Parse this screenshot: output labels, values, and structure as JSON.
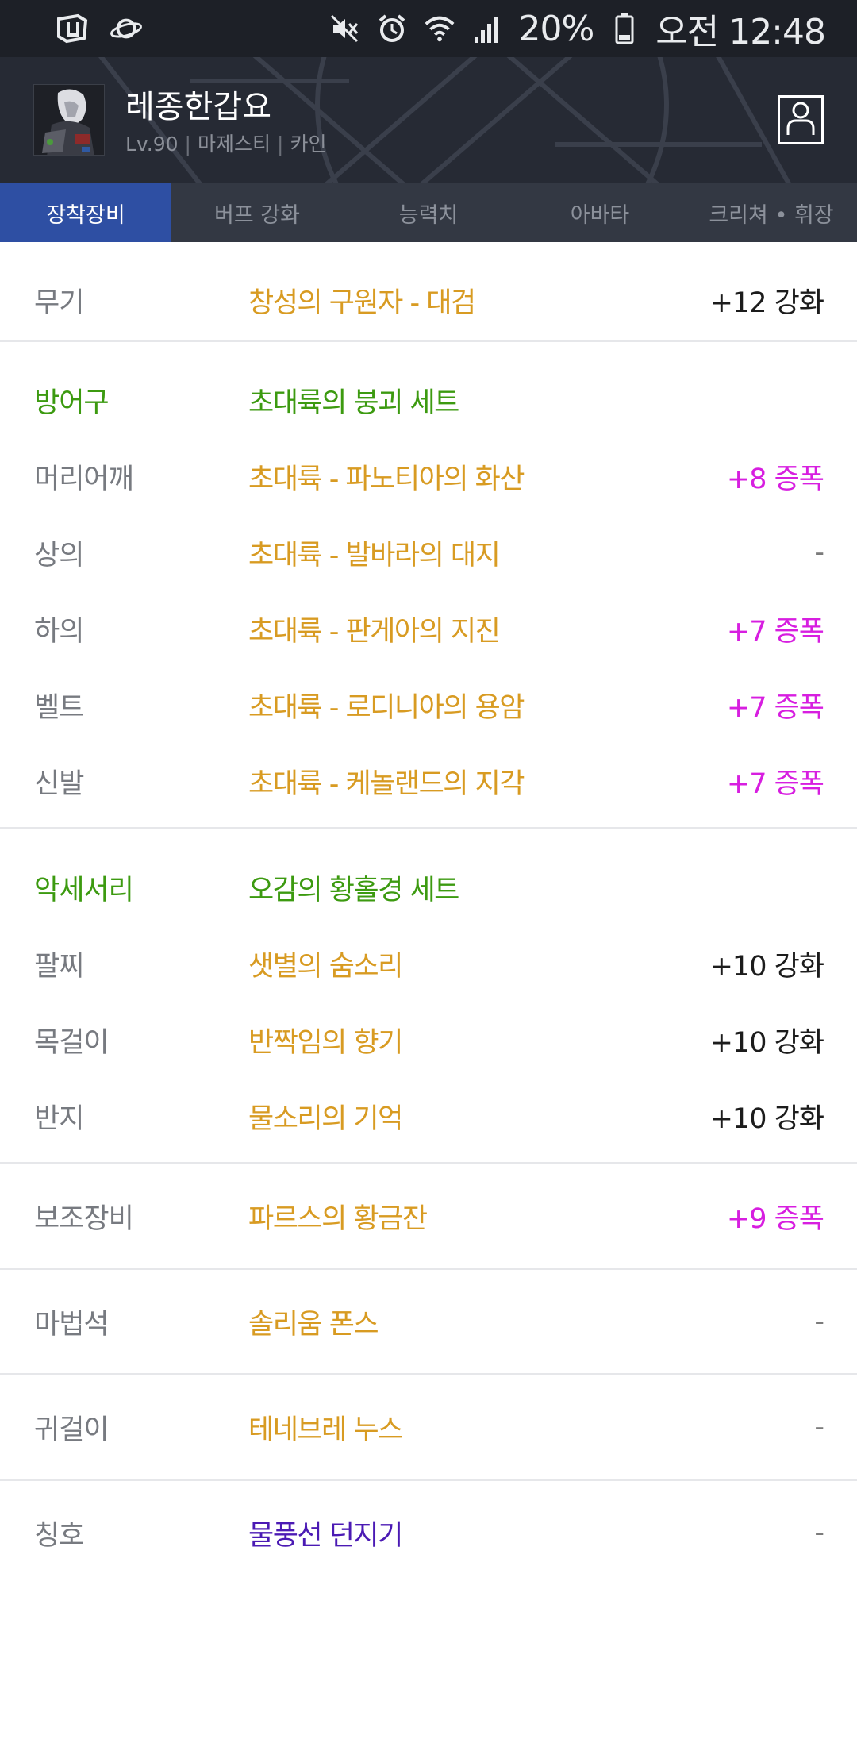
{
  "status_bar": {
    "left_icons": [
      "app-icon",
      "planet-icon"
    ],
    "right_icons": [
      "mute-icon",
      "alarm-icon",
      "wifi-icon",
      "signal-icon",
      "battery-icon"
    ],
    "battery": "20%",
    "time": "오전 12:48"
  },
  "profile": {
    "name": "레종한갑요",
    "level": "Lv.90",
    "job": "마제스티",
    "base_class": "카인",
    "separator": "|"
  },
  "tabs": [
    {
      "label": "장착장비",
      "active": true
    },
    {
      "label": "버프 강화",
      "active": false
    },
    {
      "label": "능력치",
      "active": false
    },
    {
      "label": "아바타",
      "active": false
    },
    {
      "label": "크리쳐 • 휘장",
      "active": false
    }
  ],
  "equipment": {
    "weapon": {
      "slot": "무기",
      "item": "창성의 구원자 - 대검",
      "enhance": "+12 강화"
    },
    "armor": {
      "category": "방어구",
      "set_name": "초대륙의 붕괴 세트",
      "items": [
        {
          "slot": "머리어깨",
          "item": "초대륙 - 파노티아의 화산",
          "enhance": "+8 증폭"
        },
        {
          "slot": "상의",
          "item": "초대륙 - 발바라의 대지",
          "enhance": "-"
        },
        {
          "slot": "하의",
          "item": "초대륙 - 판게아의 지진",
          "enhance": "+7 증폭"
        },
        {
          "slot": "벨트",
          "item": "초대륙 - 로디니아의 용암",
          "enhance": "+7 증폭"
        },
        {
          "slot": "신발",
          "item": "초대륙 - 케놀랜드의 지각",
          "enhance": "+7 증폭"
        }
      ]
    },
    "accessory": {
      "category": "악세서리",
      "set_name": "오감의 황홀경 세트",
      "items": [
        {
          "slot": "팔찌",
          "item": "샛별의 숨소리",
          "enhance": "+10 강화"
        },
        {
          "slot": "목걸이",
          "item": "반짝임의 향기",
          "enhance": "+10 강화"
        },
        {
          "slot": "반지",
          "item": "물소리의 기억",
          "enhance": "+10 강화"
        }
      ]
    },
    "sub_equipment": {
      "slot": "보조장비",
      "item": "파르스의 황금잔",
      "enhance": "+9 증폭"
    },
    "magic_stone": {
      "slot": "마법석",
      "item": "솔리움 폰스",
      "enhance": "-"
    },
    "earring": {
      "slot": "귀걸이",
      "item": "테네브레 누스",
      "enhance": "-"
    },
    "title": {
      "slot": "칭호",
      "item": "물풍선 던지기",
      "enhance": "-"
    }
  },
  "colors": {
    "item_gold": "#d89b22",
    "set_green": "#3c9a10",
    "amplify_magenta": "#d71ee0",
    "title_purple": "#4b1ab4",
    "tab_active": "#2e4fa3"
  }
}
